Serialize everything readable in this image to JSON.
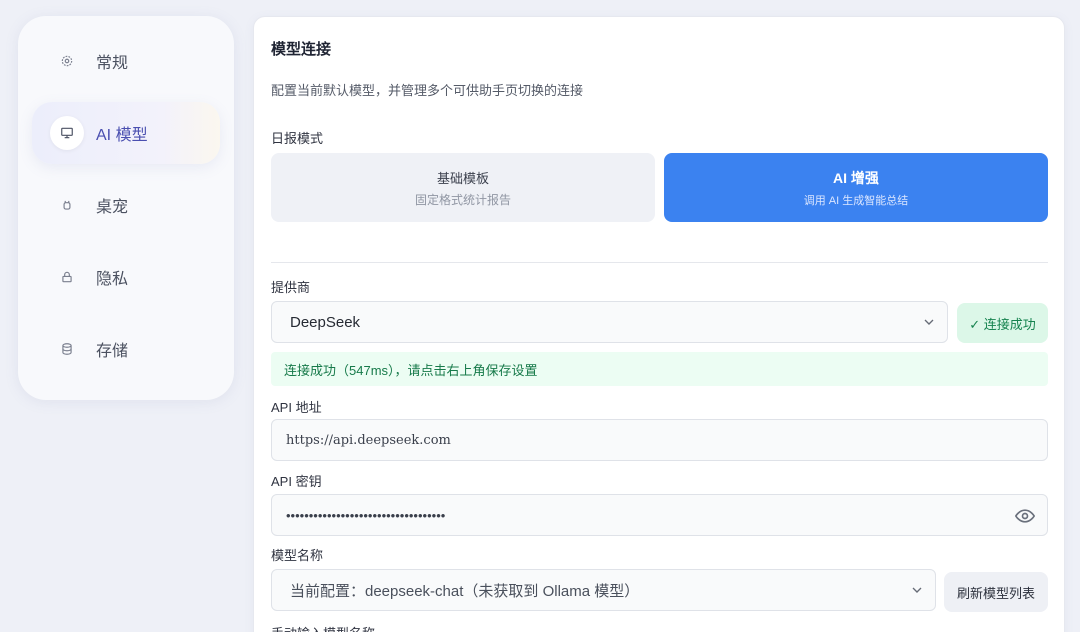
{
  "sidebar": {
    "items": [
      {
        "label": "常规",
        "icon": "gear-icon"
      },
      {
        "label": "AI 模型",
        "icon": "monitor-icon"
      },
      {
        "label": "桌宠",
        "icon": "pet-icon"
      },
      {
        "label": "隐私",
        "icon": "lock-icon"
      },
      {
        "label": "存储",
        "icon": "database-icon"
      }
    ],
    "active_index": 1
  },
  "main": {
    "title": "模型连接",
    "description": "配置当前默认模型，并管理多个可供助手页切换的连接",
    "report_mode": {
      "label": "日报模式",
      "basic": {
        "title": "基础模板",
        "subtitle": "固定格式统计报告"
      },
      "ai": {
        "title": "AI 增强",
        "subtitle": "调用 AI 生成智能总结"
      },
      "selected": "ai"
    },
    "provider": {
      "label": "提供商",
      "value": "DeepSeek",
      "status_button": "✓ 连接成功"
    },
    "success_message": "连接成功（547ms），请点击右上角保存设置",
    "api_url": {
      "label": "API 地址",
      "value": "https://api.deepseek.com"
    },
    "api_key": {
      "label": "API 密钥",
      "value": "•••••••••••••••••••••••••••••••••••"
    },
    "model": {
      "label": "模型名称",
      "value": "当前配置：deepseek-chat（未获取到 Ollama 模型）",
      "refresh_button": "刷新模型列表"
    },
    "manual_label": "手动输入模型名称"
  },
  "colors": {
    "accent": "#3b82f0",
    "success_bg": "#dcf7e8",
    "success_text": "#16834f",
    "active_nav_text": "#4a4fb0"
  }
}
